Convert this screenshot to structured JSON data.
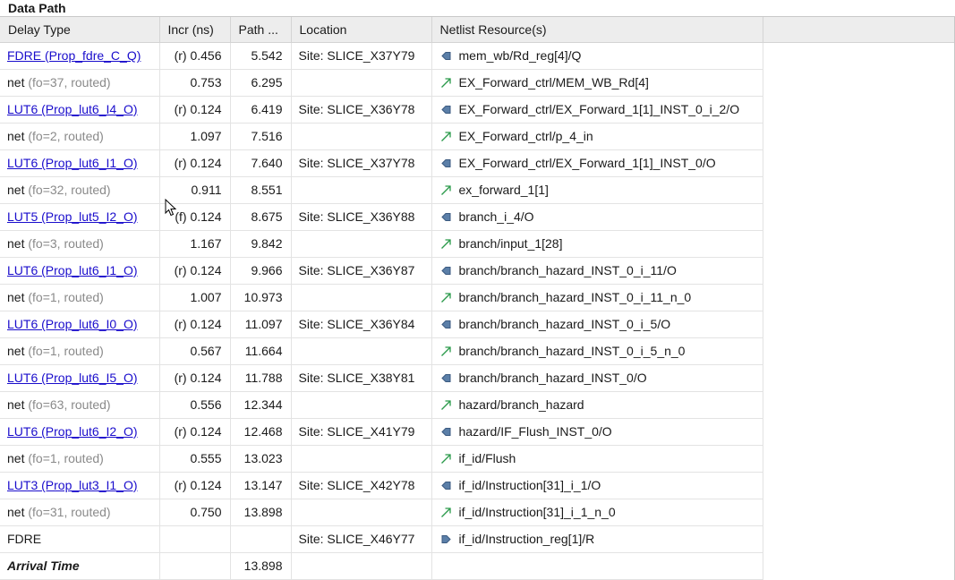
{
  "section_title": "Data Path",
  "columns": [
    "Delay Type",
    "Incr (ns)",
    "Path ...",
    "Location",
    "Netlist Resource(s)"
  ],
  "rows": [
    {
      "delay": "FDRE (Prop_fdre_C_Q)",
      "delay_link": true,
      "sub": "",
      "incr": "(r) 0.456",
      "path": "5.542",
      "location": "Site: SLICE_X37Y79",
      "resource": "mem_wb/Rd_reg[4]/Q",
      "icon": "output-pin-icon"
    },
    {
      "delay": "net",
      "delay_link": false,
      "sub": "(fo=37, routed)",
      "incr": "0.753",
      "path": "6.295",
      "location": "",
      "resource": "EX_Forward_ctrl/MEM_WB_Rd[4]",
      "icon": "net-arrow-icon"
    },
    {
      "delay": "LUT6 (Prop_lut6_I4_O)",
      "delay_link": true,
      "sub": "",
      "incr": "(r) 0.124",
      "path": "6.419",
      "location": "Site: SLICE_X36Y78",
      "resource": "EX_Forward_ctrl/EX_Forward_1[1]_INST_0_i_2/O",
      "icon": "output-pin-icon"
    },
    {
      "delay": "net",
      "delay_link": false,
      "sub": "(fo=2, routed)",
      "incr": "1.097",
      "path": "7.516",
      "location": "",
      "resource": "EX_Forward_ctrl/p_4_in",
      "icon": "net-arrow-icon"
    },
    {
      "delay": "LUT6 (Prop_lut6_I1_O)",
      "delay_link": true,
      "sub": "",
      "incr": "(r) 0.124",
      "path": "7.640",
      "location": "Site: SLICE_X37Y78",
      "resource": "EX_Forward_ctrl/EX_Forward_1[1]_INST_0/O",
      "icon": "output-pin-icon"
    },
    {
      "delay": "net",
      "delay_link": false,
      "sub": "(fo=32, routed)",
      "incr": "0.911",
      "path": "8.551",
      "location": "",
      "resource": "ex_forward_1[1]",
      "icon": "net-arrow-icon"
    },
    {
      "delay": "LUT5 (Prop_lut5_I2_O)",
      "delay_link": true,
      "sub": "",
      "incr": "(f) 0.124",
      "path": "8.675",
      "location": "Site: SLICE_X36Y88",
      "resource": "branch_i_4/O",
      "icon": "output-pin-icon"
    },
    {
      "delay": "net",
      "delay_link": false,
      "sub": "(fo=3, routed)",
      "incr": "1.167",
      "path": "9.842",
      "location": "",
      "resource": "branch/input_1[28]",
      "icon": "net-arrow-icon"
    },
    {
      "delay": "LUT6 (Prop_lut6_I1_O)",
      "delay_link": true,
      "sub": "",
      "incr": "(r) 0.124",
      "path": "9.966",
      "location": "Site: SLICE_X36Y87",
      "resource": "branch/branch_hazard_INST_0_i_11/O",
      "icon": "output-pin-icon"
    },
    {
      "delay": "net",
      "delay_link": false,
      "sub": "(fo=1, routed)",
      "incr": "1.007",
      "path": "10.973",
      "location": "",
      "resource": "branch/branch_hazard_INST_0_i_11_n_0",
      "icon": "net-arrow-icon"
    },
    {
      "delay": "LUT6 (Prop_lut6_I0_O)",
      "delay_link": true,
      "sub": "",
      "incr": "(r) 0.124",
      "path": "11.097",
      "location": "Site: SLICE_X36Y84",
      "resource": "branch/branch_hazard_INST_0_i_5/O",
      "icon": "output-pin-icon"
    },
    {
      "delay": "net",
      "delay_link": false,
      "sub": "(fo=1, routed)",
      "incr": "0.567",
      "path": "11.664",
      "location": "",
      "resource": "branch/branch_hazard_INST_0_i_5_n_0",
      "icon": "net-arrow-icon"
    },
    {
      "delay": "LUT6 (Prop_lut6_I5_O)",
      "delay_link": true,
      "sub": "",
      "incr": "(r) 0.124",
      "path": "11.788",
      "location": "Site: SLICE_X38Y81",
      "resource": "branch/branch_hazard_INST_0/O",
      "icon": "output-pin-icon"
    },
    {
      "delay": "net",
      "delay_link": false,
      "sub": "(fo=63, routed)",
      "incr": "0.556",
      "path": "12.344",
      "location": "",
      "resource": "hazard/branch_hazard",
      "icon": "net-arrow-icon"
    },
    {
      "delay": "LUT6 (Prop_lut6_I2_O)",
      "delay_link": true,
      "sub": "",
      "incr": "(r) 0.124",
      "path": "12.468",
      "location": "Site: SLICE_X41Y79",
      "resource": "hazard/IF_Flush_INST_0/O",
      "icon": "output-pin-icon"
    },
    {
      "delay": "net",
      "delay_link": false,
      "sub": "(fo=1, routed)",
      "incr": "0.555",
      "path": "13.023",
      "location": "",
      "resource": "if_id/Flush",
      "icon": "net-arrow-icon"
    },
    {
      "delay": "LUT3 (Prop_lut3_I1_O)",
      "delay_link": true,
      "sub": "",
      "incr": "(r) 0.124",
      "path": "13.147",
      "location": "Site: SLICE_X42Y78",
      "resource": "if_id/Instruction[31]_i_1/O",
      "icon": "output-pin-icon"
    },
    {
      "delay": "net",
      "delay_link": false,
      "sub": "(fo=31, routed)",
      "incr": "0.750",
      "path": "13.898",
      "location": "",
      "resource": "if_id/Instruction[31]_i_1_n_0",
      "icon": "net-arrow-icon"
    },
    {
      "delay": "FDRE",
      "delay_link": false,
      "sub": "",
      "incr": "",
      "path": "",
      "location": "Site: SLICE_X46Y77",
      "resource": "if_id/Instruction_reg[1]/R",
      "icon": "input-pin-icon"
    },
    {
      "delay": "Arrival Time",
      "delay_link": false,
      "sub": "",
      "incr": "",
      "path": "13.898",
      "location": "",
      "resource": "",
      "icon": "",
      "bold": true
    }
  ]
}
